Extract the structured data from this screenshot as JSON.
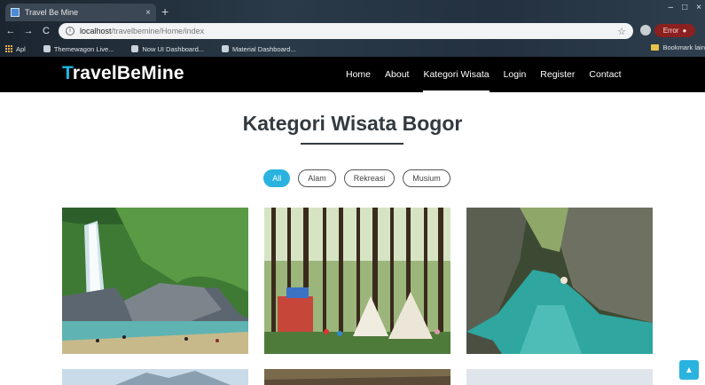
{
  "browser": {
    "tab_title": "Travel Be Mine",
    "tab_close": "×",
    "new_tab": "+",
    "window_controls": [
      "‒",
      "□",
      "×"
    ],
    "url_host": "localhost",
    "url_path": "/travelbemine/Home/index",
    "error_label": "Error",
    "bookmarks": [
      "Apl",
      "Themewagon Live...",
      "Now UI Dashboard...",
      "Material Dashboard..."
    ],
    "bookmark_right": "Bookmark lain"
  },
  "site": {
    "brand_first": "T",
    "brand_rest": "ravelBeMine",
    "brand_color": "#21b6e0",
    "menu": [
      "Home",
      "About",
      "Kategori Wisata",
      "Login",
      "Register",
      "Contact"
    ],
    "active_menu": "Kategori Wisata"
  },
  "main": {
    "title": "Kategori Wisata Bogor",
    "filters": [
      "All",
      "Alam",
      "Rekreasi",
      "Musium"
    ],
    "active_filter": "All",
    "accent": "#2ab3df"
  },
  "icons": {
    "back": "arrow-left-icon",
    "forward": "arrow-right-icon",
    "reload": "reload-icon",
    "info": "info-icon",
    "star": "star-icon",
    "scroll_top": "chevron-up-icon"
  }
}
